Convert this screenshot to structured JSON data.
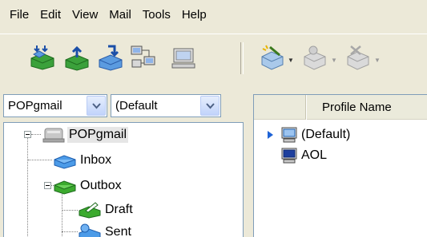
{
  "menu": [
    "File",
    "Edit",
    "View",
    "Mail",
    "Tools",
    "Help"
  ],
  "toolbar": {
    "icons": [
      "download-all-icon",
      "upload-icon",
      "download-icon",
      "connect-icon",
      "disconnect-icon",
      "wizard-icon",
      "profile-icon",
      "delete-profile-icon"
    ]
  },
  "left": {
    "account_select": "POPgmail",
    "profile_select": "(Default"
  },
  "tree": {
    "root": "POPgmail",
    "inbox": "Inbox",
    "outbox": "Outbox",
    "draft": "Draft",
    "sent": "Sent"
  },
  "right": {
    "column_header": "Profile Name",
    "profiles": [
      "(Default)",
      "AOL"
    ]
  }
}
